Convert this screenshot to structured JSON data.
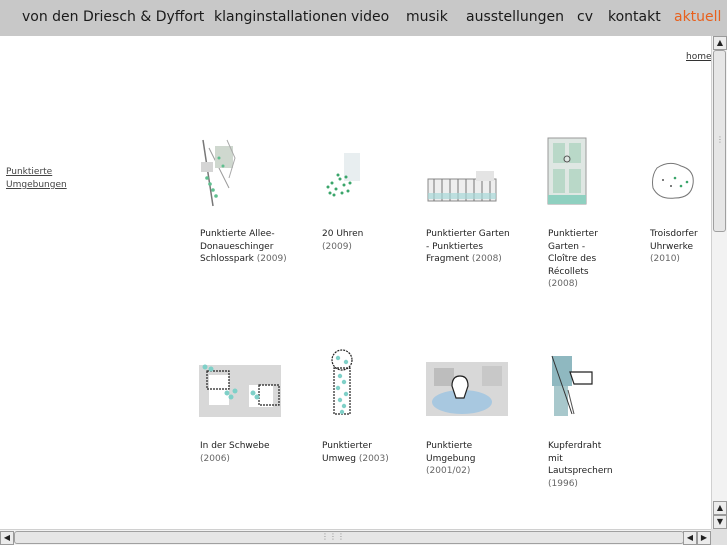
{
  "nav": {
    "title": "von den Driesch & Dyffort",
    "items": [
      "klanginstallationen",
      "video",
      "musik",
      "ausstellungen",
      "cv",
      "kontakt",
      "aktuell"
    ],
    "active_color": "#e8601c",
    "bg_color": "#c8c8c8"
  },
  "home_link": "home",
  "side_link": [
    "Punktierte",
    "Umgebungen"
  ],
  "works": [
    {
      "lines": [
        "Punktierte Allee-",
        "Donaueschinger",
        "Schlosspark"
      ],
      "year": "(2009)"
    },
    {
      "lines": [
        "20 Uhren"
      ],
      "year": "(2009)"
    },
    {
      "lines": [
        "Punktierter Garten",
        "- Punktiertes",
        "Fragment"
      ],
      "year": "(2008)"
    },
    {
      "lines": [
        "Punktierter",
        "Garten -",
        "Cloître des",
        "Récollets"
      ],
      "year": "(2008)"
    },
    {
      "lines": [
        "Troisdorfer",
        "Uhrwerke"
      ],
      "year": "(2010)"
    },
    {
      "lines": [
        "In der Schwebe"
      ],
      "year": "(2006)"
    },
    {
      "lines": [
        "Punktierter",
        "Umweg"
      ],
      "year": "(2003)"
    },
    {
      "lines": [
        "Punktierte",
        "Umgebung"
      ],
      "year": "(2001/02)"
    },
    {
      "lines": [
        "Kupferdraht",
        "mit",
        "Lautsprechern"
      ],
      "year": "(1996)"
    }
  ],
  "icons": [
    "scroll-up-arrow-icon",
    "scroll-down-arrow-icon",
    "scroll-left-arrow-icon",
    "scroll-right-arrow-icon"
  ]
}
